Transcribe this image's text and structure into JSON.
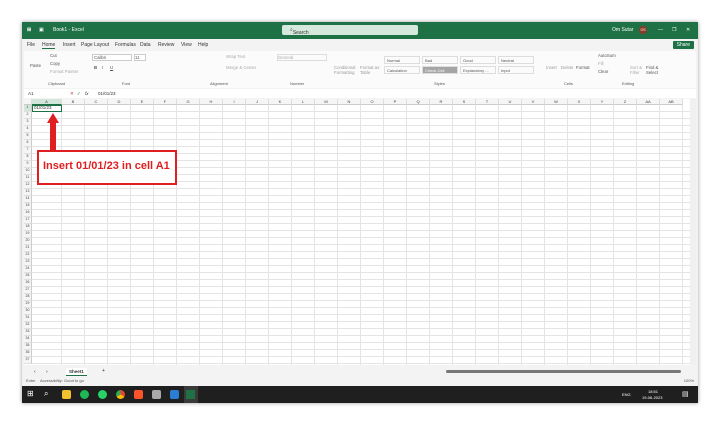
{
  "title": {
    "doc": "Book1 - Excel",
    "search_placeholder": "Search",
    "user": "Om Sutar",
    "initials": "OS",
    "minimize": "—",
    "restore": "❐",
    "close": "✕"
  },
  "menu": [
    "File",
    "Home",
    "Insert",
    "Page Layout",
    "Formulas",
    "Data",
    "Review",
    "View",
    "Help"
  ],
  "share": "Share",
  "ribbon": {
    "clipboard": {
      "paste": "Paste",
      "cut": "Cut",
      "copy": "Copy",
      "painter": "Format Painter",
      "label": "Clipboard"
    },
    "font": {
      "name": "Calibri",
      "size": "11",
      "label": "Font",
      "bold": "B",
      "italic": "I",
      "underline": "U"
    },
    "alignment": {
      "wrap": "Wrap Text",
      "merge": "Merge & Center",
      "label": "Alignment"
    },
    "number": {
      "format": "General",
      "label": "Number"
    },
    "styles": {
      "conditional": "Conditional Formatting",
      "table": "Format as Table",
      "cells": [
        "Normal",
        "Bad",
        "Good",
        "Neutral",
        "Calculation",
        "Check Cell",
        "Explanatory ...",
        "Input"
      ],
      "label": "Styles"
    },
    "cells": {
      "insert": "Insert",
      "delete": "Delete",
      "format": "Format",
      "label": "Cells"
    },
    "editing": {
      "autosum": "AutoSum",
      "fill": "Fill",
      "clear": "Clear",
      "sort": "Sort & Filter",
      "find": "Find & Select",
      "label": "Editing"
    }
  },
  "formula": {
    "namebox": "A1",
    "fx": "fx",
    "value": "01/01/23"
  },
  "grid": {
    "columns": [
      "A",
      "B",
      "C",
      "D",
      "E",
      "F",
      "G",
      "H",
      "I",
      "J",
      "K",
      "L",
      "M",
      "N",
      "O",
      "P",
      "Q",
      "R",
      "S",
      "T",
      "U",
      "V",
      "W",
      "X",
      "Y",
      "Z",
      "AA",
      "AB"
    ],
    "rows": 37,
    "a1_value": "01/01/23"
  },
  "sheets": {
    "tab": "Sheet1",
    "add": "+"
  },
  "status": {
    "mode": "Enter",
    "accessibility": "Accessibility: Good to go",
    "zoom": "100%"
  },
  "taskbar": {
    "lang": "ENG",
    "time": "18:51",
    "date": "19-06-2023"
  },
  "annotation": "Insert 01/01/23 in cell A1",
  "colors": {
    "excel_green": "#1e7145",
    "annotation_red": "#e02020"
  }
}
